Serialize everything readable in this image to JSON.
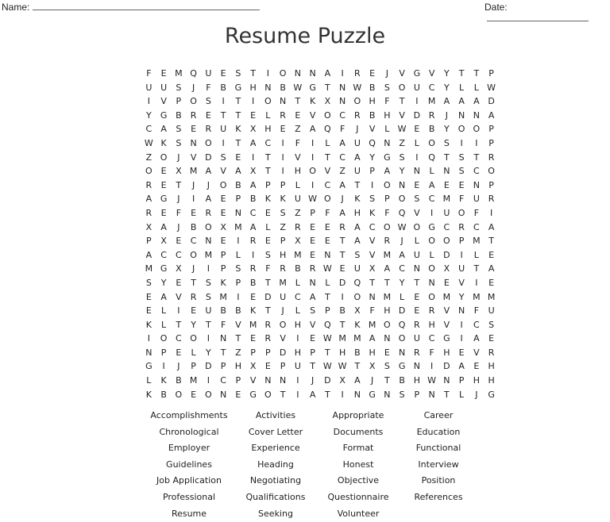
{
  "header": {
    "name_label": "Name:",
    "date_label": "Date:"
  },
  "title": "Resume Puzzle",
  "grid": [
    "FEMQUESTIONNAIREJVGVYTTP",
    "UUSJFBGHNBWGTNWBSOUCYLLW",
    "IVPOSITIONTKXNOHFTIMAAAD",
    "YGBRETTELREVOCRBHVDRJNNA",
    "CASERUKXHEZAQFJVLWEBYOOP",
    "WKSNOITACIFILAUQNZLOSIIP",
    "ZOJVDSEITIVITCAYGSIQTSTR",
    "OEXMAVAXTIHOVZUPAYNLNSCO",
    "RETJJOBAPPLICATIONEAEENP",
    "AGJIAEPBKKUWOJKSPOSCMFUR",
    "REFERENCESZPFAHKFQVIUOFI",
    "XAJBOXMALZREERACOWOGCRCA",
    "PXECNEIREPXEETAVRJLOOPMT",
    "ACCOMPLISHMENTSVMAULDILE",
    "MGXJIPSRFRBRWEUXACNOXUTA",
    "SYETSKPBTMLNLDQTTYTNEVIE",
    "EAVRSMIEDUCATIONMLEOMYMM",
    "ELIEUBBKTJLSPBXFHDERVNFU",
    "KLTYTFVMROHVQTKMOQRHVICS",
    "IOCOINTERVIEWMMANOUCGIAE",
    "NPELYTZPPDHPTHBHENRFHEVR",
    "GIJPDPHXEPUTWWTXSGNIDAEH",
    "LKBMICPVNNIJDXAJTBHWNPHH",
    "KBOEONEGOTIATINGNSPNTLJG"
  ],
  "words": [
    "Accomplishments",
    "Activities",
    "Appropriate",
    "Career",
    "Chronological",
    "Cover Letter",
    "Documents",
    "Education",
    "Employer",
    "Experience",
    "Format",
    "Functional",
    "Guidelines",
    "Heading",
    "Honest",
    "Interview",
    "Job Application",
    "Negotiating",
    "Objective",
    "Position",
    "Professional",
    "Qualifications",
    "Questionnaire",
    "References",
    "Resume",
    "Seeking",
    "Volunteer"
  ]
}
